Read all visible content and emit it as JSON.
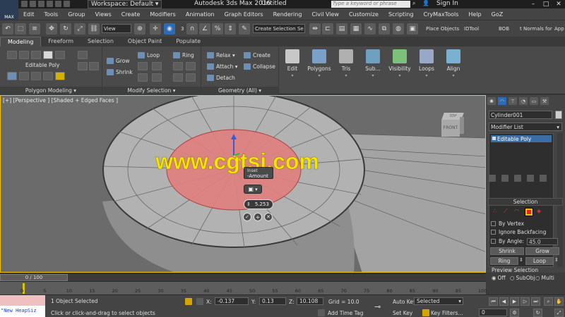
{
  "app": {
    "workspace_label": "Workspace: Default",
    "title": "Autodesk 3ds Max 2016",
    "document": "Untitled",
    "search_placeholder": "Type a keyword or phrase",
    "sign_in": "Sign In",
    "logo_text": "MAX"
  },
  "menu": [
    "Edit",
    "Tools",
    "Group",
    "Views",
    "Create",
    "Modifiers",
    "Animation",
    "Graph Editors",
    "Rendering",
    "Civil View",
    "Customize",
    "Scripting",
    "CryMaxTools",
    "Help",
    "GoZ"
  ],
  "toolbar": {
    "filter": "All",
    "ref_coord": "View",
    "selection_set": "Create Selection Se",
    "snap_label": "3",
    "place_objects": "Place Objects",
    "idtool": "IDTool",
    "bob": "BOB",
    "normals": "t Normals for",
    "app_label": "App"
  },
  "ribbon": {
    "tabs": [
      "Modeling",
      "Freeform",
      "Selection",
      "Object Paint",
      "Populate"
    ],
    "active_tab": "Modeling",
    "polygon_modeling": {
      "title": "Polygon Modeling",
      "object_type": "Editable Poly"
    },
    "modify_selection": {
      "title": "Modify Selection",
      "grow": "Grow",
      "shrink": "Shrink",
      "loop": "Loop",
      "ring": "Ring"
    },
    "geometry": {
      "title": "Geometry (All)",
      "relax": "Relax",
      "create": "Create",
      "attach": "Attach",
      "collapse": "Collapse",
      "detach": "Detach"
    },
    "big_buttons": [
      "Edit",
      "Polygons",
      "Tris",
      "Sub...",
      "Visibility",
      "Loops",
      "Align"
    ]
  },
  "viewport": {
    "label": "[+] [Perspective ] [Shaded + Edged Faces ]",
    "viewcube_top": "TOP",
    "viewcube_front": "FRONT",
    "watermark": "www.cgtsj.com",
    "caddy": {
      "title": "Inset",
      "param": "Amount",
      "value": "5.253"
    }
  },
  "command_panel": {
    "object_name": "Cylinder001",
    "modifier_list": "Modifier List",
    "stack": [
      "Editable Poly"
    ],
    "selection": {
      "title": "Selection",
      "by_vertex": "By Vertex",
      "ignore_backfacing": "Ignore Backfacing",
      "by_angle": "By Angle:",
      "angle_value": "45.0",
      "shrink": "Shrink",
      "grow": "Grow",
      "ring": "Ring",
      "loop": "Loop",
      "preview_title": "Preview Selection",
      "preview_options": [
        "Off",
        "SubObj",
        "Multi"
      ],
      "preview_selected": "Off"
    }
  },
  "timeline": {
    "frame_label": "0 / 100",
    "ticks": [
      "0",
      "5",
      "10",
      "15",
      "20",
      "25",
      "30",
      "35",
      "40",
      "45",
      "50",
      "55",
      "60",
      "65",
      "70",
      "75",
      "80",
      "85",
      "90",
      "95",
      "100"
    ]
  },
  "status": {
    "listener_text": "\"New HeapSiz",
    "objects_selected": "1 Object Selected",
    "prompt": "Click or click-and-drag to select objects",
    "x_label": "X:",
    "x_value": "-0.137",
    "y_label": "Y:",
    "y_value": "0.13",
    "z_label": "Z:",
    "z_value": "10.108",
    "grid": "Grid = 10.0",
    "add_time_tag": "Add Time Tag",
    "auto_key": "Auto Key",
    "set_key": "Set Key",
    "key_mode": "Selected",
    "key_filters": "Key Filters...",
    "frame_field": "0"
  }
}
